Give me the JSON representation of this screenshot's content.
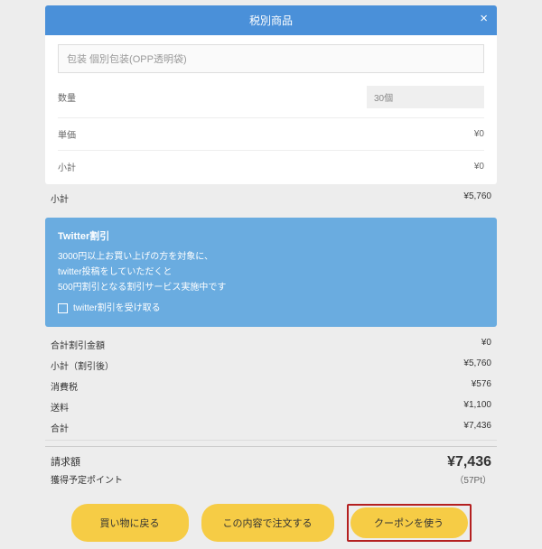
{
  "modal": {
    "title": "税別商品",
    "close": "×"
  },
  "item": {
    "name": "包装 個別包装(OPP透明袋)",
    "qty_label": "数量",
    "qty_value": "30個",
    "unit_label": "単価",
    "unit_value": "¥0",
    "sub_label": "小計",
    "sub_value": "¥0"
  },
  "subtotal": {
    "label": "小計",
    "value": "¥5,760"
  },
  "promo": {
    "title": "Twitter割引",
    "line1": "3000円以上お買い上げの方を対象に、",
    "line2": "twitter投稿をしていただくと",
    "line3": "500円割引となる割引サービス実施中です",
    "checkbox_label": "twitter割引を受け取る"
  },
  "summary": {
    "discount_label": "合計割引金額",
    "discount_value": "¥0",
    "after_label": "小計（割引後）",
    "after_value": "¥5,760",
    "tax_label": "消費税",
    "tax_value": "¥576",
    "ship_label": "送料",
    "ship_value": "¥1,100",
    "total_label": "合計",
    "total_value": "¥7,436"
  },
  "grand": {
    "label": "請求額",
    "value": "¥7,436",
    "points_label": "獲得予定ポイント",
    "points_value": "（57Pt）"
  },
  "buttons": {
    "back": "買い物に戻る",
    "order": "この内容で注文する",
    "coupon": "クーポンを使う"
  }
}
